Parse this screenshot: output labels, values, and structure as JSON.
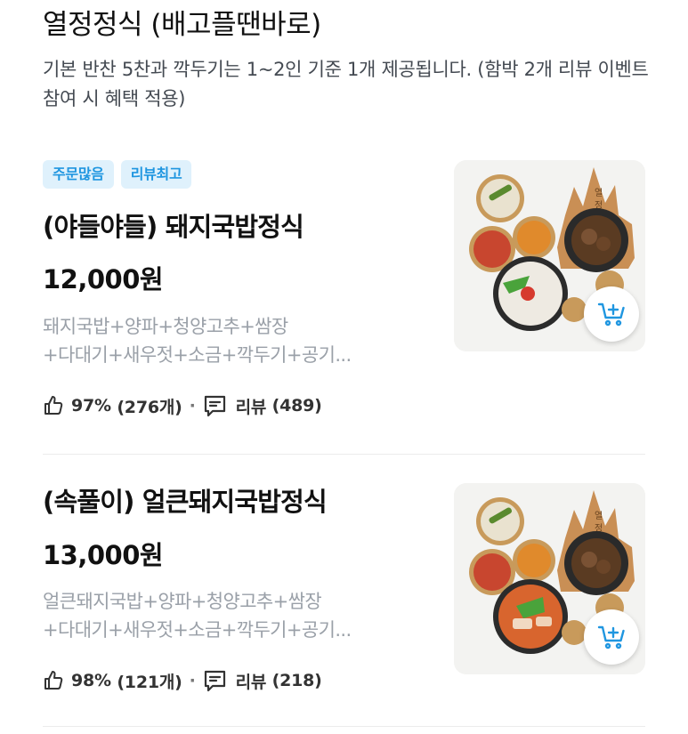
{
  "section": {
    "title": "열정정식 (배고플땐바로)",
    "description": "기본 반찬 5찬과 깍두기는 1~2인 기준 1개 제공됩니다. (함박 2개 리뷰 이벤트 참여 시 혜택 적용)"
  },
  "items": [
    {
      "badges": [
        "주문많음",
        "리뷰최고"
      ],
      "name": "(야들야들) 돼지국밥정식",
      "price": "12,000원",
      "desc_line1": "돼지국밥+양파+청양고추+쌈장",
      "desc_line2": "+다대기+새우젓+소금+깍두기+공기...",
      "like_rate": "97%",
      "like_count": "(276개)",
      "separator": "·",
      "review_label": "리뷰",
      "review_count": "(489)",
      "soup_color": "#eeeae2",
      "thumb_icon": "gukbap-meal-photo",
      "cart_icon": "add-to-cart-icon"
    },
    {
      "badges": [],
      "name": "(속풀이) 얼큰돼지국밥정식",
      "price": "13,000원",
      "desc_line1": "얼큰돼지국밥+양파+청양고추+쌈장",
      "desc_line2": "+다대기+새우젓+소금+깍두기+공기...",
      "like_rate": "98%",
      "like_count": "(121개)",
      "separator": "·",
      "review_label": "리뷰",
      "review_count": "(218)",
      "soup_color": "#d8652e",
      "thumb_icon": "spicy-gukbap-meal-photo",
      "cart_icon": "add-to-cart-icon"
    }
  ],
  "colors": {
    "accent": "#1f96e0",
    "badge_bg": "#dff1fc",
    "desc_text": "#9aa0a8"
  }
}
